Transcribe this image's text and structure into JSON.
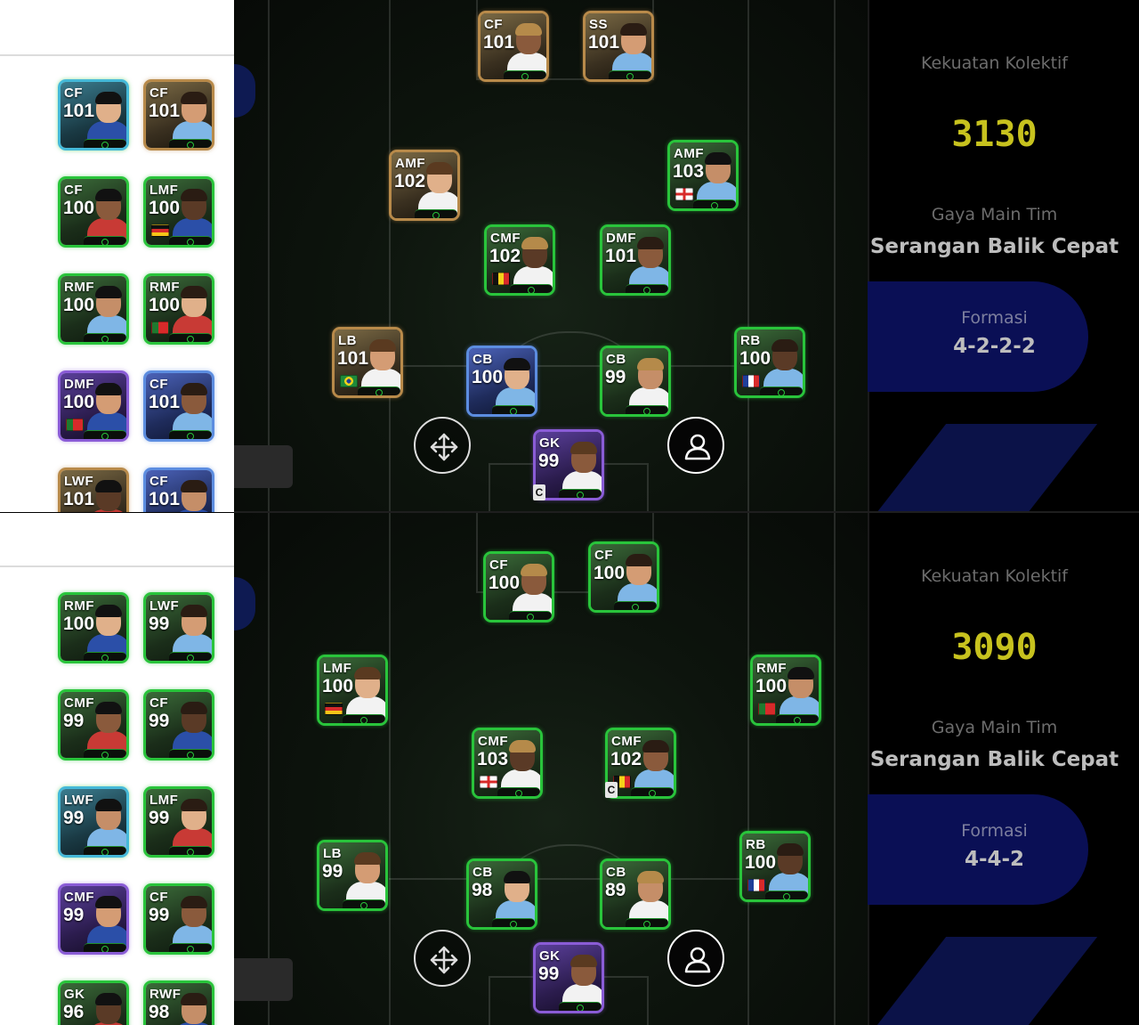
{
  "panels": [
    {
      "id": "top",
      "collective_strength_label": "Kekuatan Kolektif",
      "collective_strength": "3130",
      "team_style_label": "Gaya Main Tim",
      "team_style": "Serangan Balik Cepat",
      "formation_label": "Formasi",
      "formation": "4-2-2-2",
      "captain_mark": "C",
      "pitch_players": [
        {
          "pos": "CF",
          "rating": "101",
          "flag": "none"
        },
        {
          "pos": "SS",
          "rating": "101",
          "flag": "none"
        },
        {
          "pos": "AMF",
          "rating": "102",
          "flag": "none"
        },
        {
          "pos": "AMF",
          "rating": "103",
          "flag": "england"
        },
        {
          "pos": "CMF",
          "rating": "102",
          "flag": "belgium"
        },
        {
          "pos": "DMF",
          "rating": "101",
          "flag": "none"
        },
        {
          "pos": "LB",
          "rating": "101",
          "flag": "brazil"
        },
        {
          "pos": "CB",
          "rating": "100",
          "flag": "none"
        },
        {
          "pos": "CB",
          "rating": "99",
          "flag": "none"
        },
        {
          "pos": "RB",
          "rating": "100",
          "flag": "france"
        },
        {
          "pos": "GK",
          "rating": "99",
          "flag": "none"
        }
      ],
      "bench": [
        {
          "pos": "CF",
          "rating": "101",
          "flag": "none"
        },
        {
          "pos": "CF",
          "rating": "101",
          "flag": "none"
        },
        {
          "pos": "CF",
          "rating": "100",
          "flag": "none"
        },
        {
          "pos": "LMF",
          "rating": "100",
          "flag": "germany"
        },
        {
          "pos": "RMF",
          "rating": "100",
          "flag": "none"
        },
        {
          "pos": "RMF",
          "rating": "100",
          "flag": "portugal"
        },
        {
          "pos": "DMF",
          "rating": "100",
          "flag": "portugal"
        },
        {
          "pos": "CF",
          "rating": "101",
          "flag": "none"
        },
        {
          "pos": "LWF",
          "rating": "101",
          "flag": "none"
        },
        {
          "pos": "CF",
          "rating": "101",
          "flag": "none"
        }
      ]
    },
    {
      "id": "bottom",
      "collective_strength_label": "Kekuatan Kolektif",
      "collective_strength": "3090",
      "team_style_label": "Gaya Main Tim",
      "team_style": "Serangan Balik Cepat",
      "formation_label": "Formasi",
      "formation": "4-4-2",
      "captain_mark": "C",
      "pitch_players": [
        {
          "pos": "CF",
          "rating": "100",
          "flag": "none"
        },
        {
          "pos": "CF",
          "rating": "100",
          "flag": "none"
        },
        {
          "pos": "LMF",
          "rating": "100",
          "flag": "germany"
        },
        {
          "pos": "RMF",
          "rating": "100",
          "flag": "portugal"
        },
        {
          "pos": "CMF",
          "rating": "103",
          "flag": "england"
        },
        {
          "pos": "CMF",
          "rating": "102",
          "flag": "belgium"
        },
        {
          "pos": "LB",
          "rating": "99",
          "flag": "none"
        },
        {
          "pos": "CB",
          "rating": "98",
          "flag": "none"
        },
        {
          "pos": "CB",
          "rating": "89",
          "flag": "none"
        },
        {
          "pos": "RB",
          "rating": "100",
          "flag": "france"
        },
        {
          "pos": "GK",
          "rating": "99",
          "flag": "none"
        }
      ],
      "bench": [
        {
          "pos": "RMF",
          "rating": "100",
          "flag": "none"
        },
        {
          "pos": "LWF",
          "rating": "99",
          "flag": "none"
        },
        {
          "pos": "CMF",
          "rating": "99",
          "flag": "none"
        },
        {
          "pos": "CF",
          "rating": "99",
          "flag": "none"
        },
        {
          "pos": "LWF",
          "rating": "99",
          "flag": "none"
        },
        {
          "pos": "LMF",
          "rating": "99",
          "flag": "none"
        },
        {
          "pos": "CMF",
          "rating": "99",
          "flag": "none"
        },
        {
          "pos": "CF",
          "rating": "99",
          "flag": "none"
        },
        {
          "pos": "GK",
          "rating": "96",
          "flag": "none"
        },
        {
          "pos": "RWF",
          "rating": "98",
          "flag": "none"
        }
      ]
    }
  ],
  "icons": {
    "move": "move-arrows-icon",
    "player": "person-icon"
  },
  "colors": {
    "card_green": "#29c43b",
    "strength_yellow": "#c7c21e",
    "formation_blue": "#0a0f55"
  }
}
